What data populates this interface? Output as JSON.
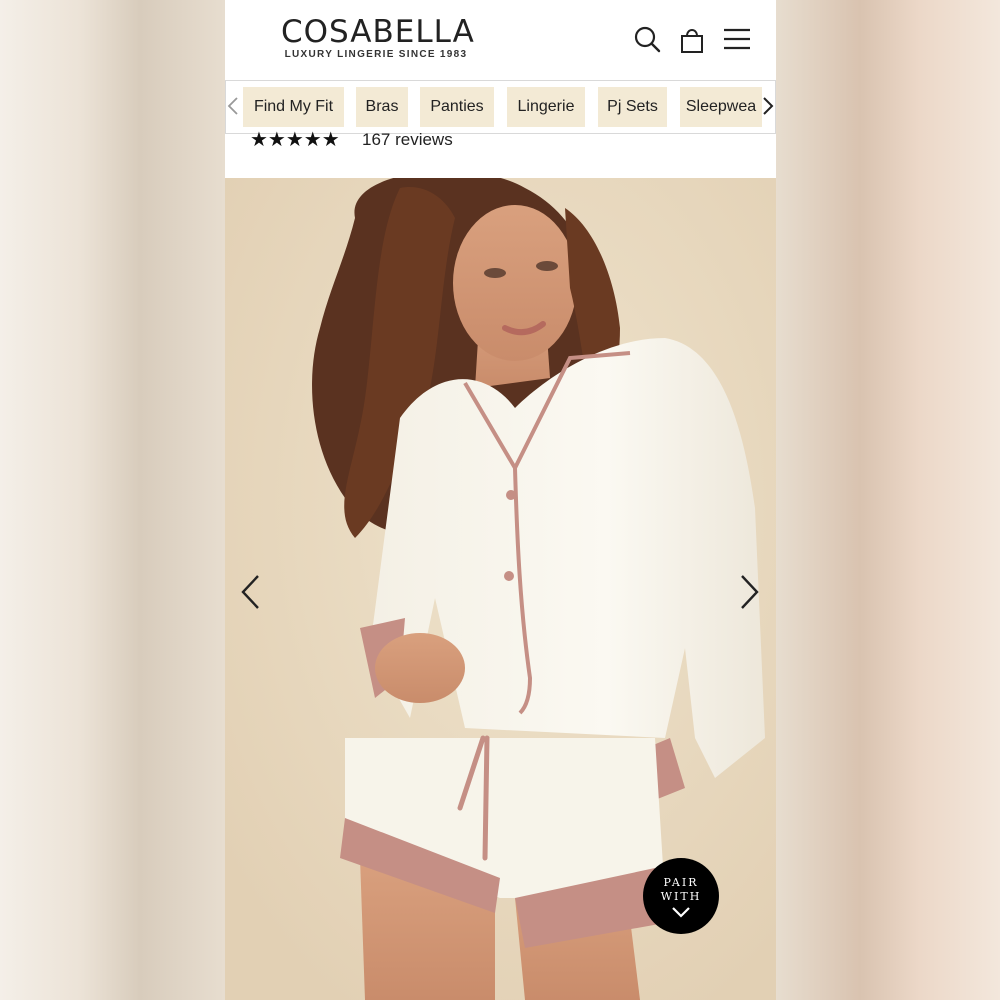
{
  "brand": {
    "name": "COSABELLA",
    "tagline": "LUXURY LINGERIE SINCE 1983"
  },
  "header": {
    "icons": [
      "search-icon",
      "shopping-bag-icon",
      "menu-icon"
    ]
  },
  "nav": {
    "items": [
      {
        "label": "Find My Fit"
      },
      {
        "label": "Bras"
      },
      {
        "label": "Panties"
      },
      {
        "label": "Lingerie"
      },
      {
        "label": "Pj Sets"
      },
      {
        "label": "Sleepwea"
      }
    ]
  },
  "product": {
    "stars": "★★★★★",
    "rating": 5,
    "review_count": "167 reviews"
  },
  "photo": {
    "pair_with_line1": "PAIR",
    "pair_with_line2": "WITH"
  },
  "colors": {
    "chip_bg": "#f3ead5",
    "pajama": "#f8f5ec",
    "trim": "#c58f85",
    "background": "#e8d8be"
  }
}
